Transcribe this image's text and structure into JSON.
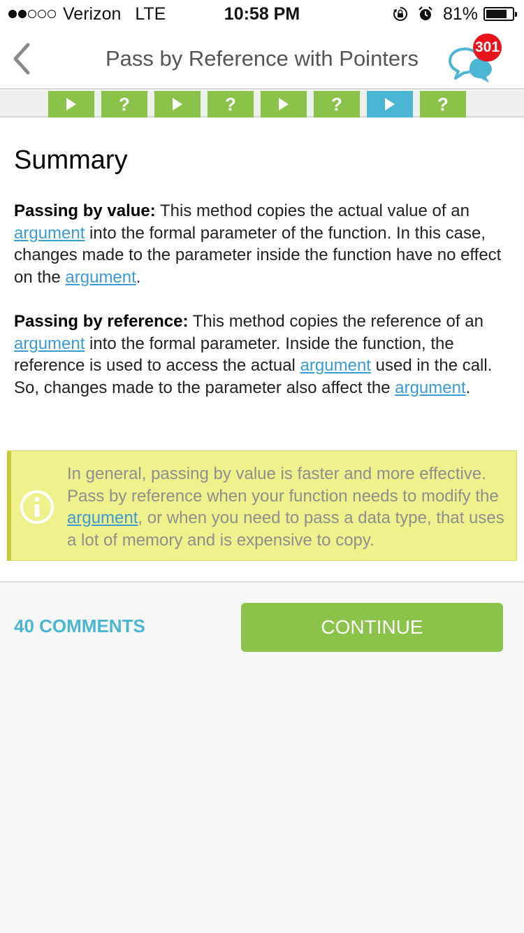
{
  "status_bar": {
    "carrier": "Verizon",
    "network": "LTE",
    "time": "10:58 PM",
    "battery_percent": "81%",
    "battery_level": 0.81,
    "signal_bars_filled": 2,
    "signal_bars_total": 5,
    "icons": [
      "signal-dots-icon",
      "orientation-lock-icon",
      "alarm-icon",
      "battery-icon"
    ]
  },
  "nav": {
    "title": "Pass by Reference with Pointers",
    "back_icon": "chevron-left-icon",
    "chat_icon": "chat-bubbles-icon",
    "chat_badge": "301"
  },
  "steps": [
    {
      "type": "play",
      "current": false
    },
    {
      "type": "quiz",
      "label": "?",
      "current": false
    },
    {
      "type": "play",
      "current": false
    },
    {
      "type": "quiz",
      "label": "?",
      "current": false
    },
    {
      "type": "play",
      "current": false
    },
    {
      "type": "quiz",
      "label": "?",
      "current": false
    },
    {
      "type": "play",
      "current": true
    },
    {
      "type": "quiz",
      "label": "?",
      "current": false
    }
  ],
  "lesson": {
    "heading": "Summary",
    "para1": {
      "bold": "Passing by value:",
      "t1": " This method copies the actual value of an ",
      "link1": "argument",
      "t2": " into the formal parameter of the function. In this case, changes made to the parameter inside the function have no effect on the ",
      "link2": "argument",
      "t3": "."
    },
    "para2": {
      "bold": "Passing by reference:",
      "t1": " This method copies the reference of an ",
      "link1": "argument",
      "t2": " into the formal parameter. Inside the function, the reference is used to access the actual ",
      "link2": "argument",
      "t3": " used in the call. So, changes made to the parameter also affect the ",
      "link3": "argument",
      "t4": "."
    },
    "note": {
      "icon": "info-icon",
      "t1": "In general, passing by value is faster and more effective. Pass by reference when your function needs to modify the ",
      "link": "argument",
      "t2": ", or when you need to pass a data type, that uses a lot of memory and is expensive to copy."
    }
  },
  "footer": {
    "comments_label": "40 COMMENTS",
    "continue_label": "CONTINUE"
  },
  "colors": {
    "accent_green": "#8bc34a",
    "accent_blue": "#4ab6d4",
    "link_blue": "#3a9bd6",
    "note_yellow": "#eef18c",
    "badge_red": "#e8141c"
  }
}
